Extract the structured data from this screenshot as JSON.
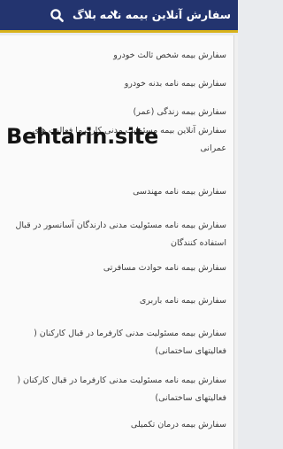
{
  "topbar": {
    "title": "سفارش آنلاین بیمه نامه",
    "blog_label": "بلاگ",
    "chevron_icon": "chevron-down-icon",
    "search_icon": "search-icon",
    "colors": {
      "background": "#23346f",
      "accent": "#d8b21a",
      "text": "#ffffff"
    }
  },
  "menu": {
    "items": [
      {
        "label": "سفارش بیمه شخص ثالث خودرو"
      },
      {
        "label": "سفارش بیمه نامه بدنه خودرو"
      },
      {
        "label": "سفارش بیمه زندگی (عمر)"
      },
      {
        "label": "سفارش آنلاین بیمه مسئولیت مدنی کارفرما فعالیت های عمرانی"
      },
      {
        "label": "سفارش بیمه نامه مهندسی"
      },
      {
        "label": "سفارش بیمه نامه مسئولیت مدنی دارندگان آسانسور در قبال استفاده کنندگان"
      },
      {
        "label": "سفارش بیمه نامه حوادث مسافرتی"
      },
      {
        "label": "سفارش بیمه نامه باربری"
      },
      {
        "label": "سفارش بیمه مسئولیت مدنی کارفرما در قبال کارکنان ( فعالیتهای ساختمانی)"
      },
      {
        "label": "سفارش بیمه نامه مسئولیت مدنی کارفرما در قبال کارکنان ( فعالیتهای ساختمانی)"
      },
      {
        "label": "سفارش بیمه درمان تکمیلی"
      }
    ]
  },
  "watermark": {
    "text": "Behtarin.site"
  }
}
